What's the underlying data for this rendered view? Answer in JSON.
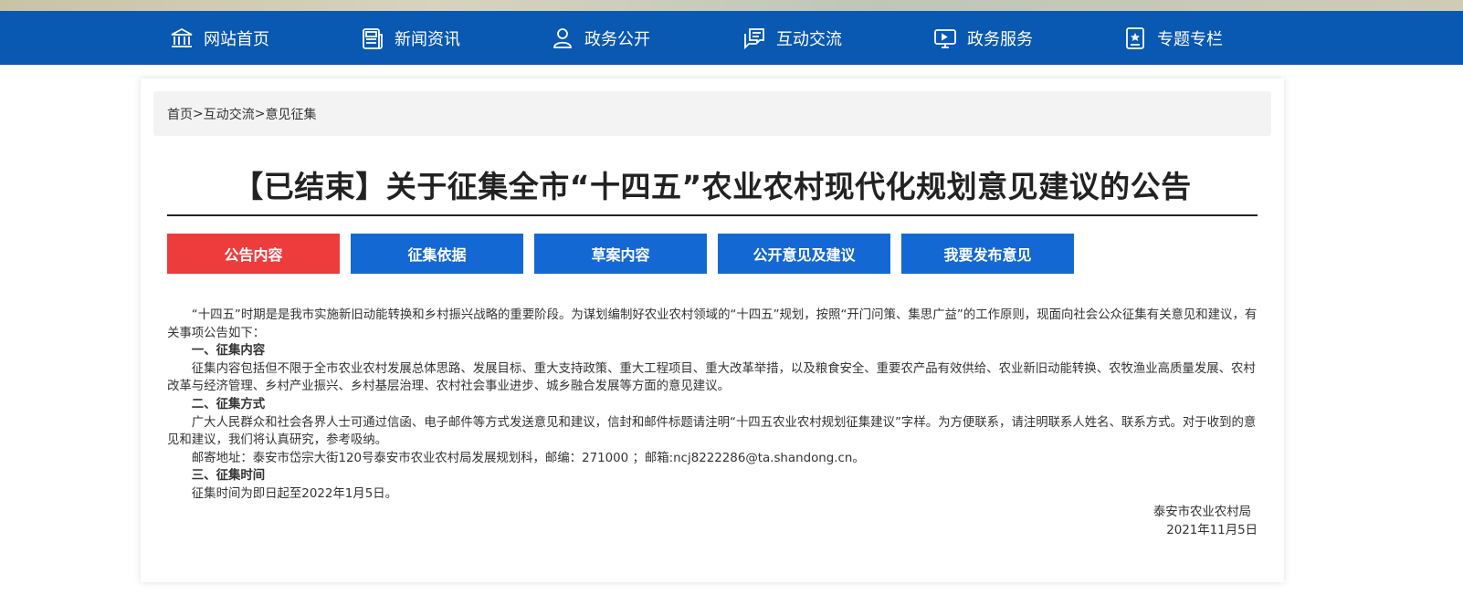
{
  "nav": {
    "items": [
      {
        "label": "网站首页",
        "icon": "bank-icon"
      },
      {
        "label": "新闻资讯",
        "icon": "news-icon"
      },
      {
        "label": "政务公开",
        "icon": "person-icon"
      },
      {
        "label": "互动交流",
        "icon": "chat-icon"
      },
      {
        "label": "政务服务",
        "icon": "monitor-icon"
      },
      {
        "label": "专题专栏",
        "icon": "star-book-icon"
      }
    ]
  },
  "breadcrumb": {
    "home": "首页",
    "sep1": ">",
    "section": "互动交流",
    "sep2": ">",
    "current": "意见征集"
  },
  "title": "【已结束】关于征集全市“十四五”农业农村现代化规划意见建议的公告",
  "tabs": [
    {
      "label": "公告内容",
      "active": true
    },
    {
      "label": "征集依据",
      "active": false
    },
    {
      "label": "草案内容",
      "active": false
    },
    {
      "label": "公开意见及建议",
      "active": false
    },
    {
      "label": "我要发布意见",
      "active": false
    }
  ],
  "content": {
    "intro": "“十四五”时期是是我市实施新旧动能转换和乡村振兴战略的重要阶段。为谋划编制好农业农村领域的“十四五”规划，按照“开门问策、集思广益”的工作原则，现面向社会公众征集有关意见和建议，有关事项公告如下：",
    "h1": "一、征集内容",
    "p1": "征集内容包括但不限于全市农业农村发展总体思路、发展目标、重大支持政策、重大工程项目、重大改革举措，以及粮食安全、重要农产品有效供给、农业新旧动能转换、农牧渔业高质量发展、农村改革与经济管理、乡村产业振兴、乡村基层治理、农村社会事业进步、城乡融合发展等方面的意见建议。",
    "h2": "二、征集方式",
    "p2": "广大人民群众和社会各界人士可通过信函、电子邮件等方式发送意见和建议，信封和邮件标题请注明“十四五农业农村规划征集建议”字样。为方便联系，请注明联系人姓名、联系方式。对于收到的意见和建议，我们将认真研究，参考吸纳。",
    "p2b": "邮寄地址：泰安市岱宗大街120号泰安市农业农村局发展规划科，邮编：271000 ；邮箱:ncj8222286@ta.shandong.cn。",
    "h3": "三、征集时间",
    "p3": "征集时间为即日起至2022年1月5日。"
  },
  "signature": {
    "org": "泰安市农业农村局",
    "date": "2021年11月5日"
  },
  "colors": {
    "nav_bg": "#0958b1",
    "tab_active": "#ee3b3b",
    "tab_inactive": "#1468d4"
  }
}
